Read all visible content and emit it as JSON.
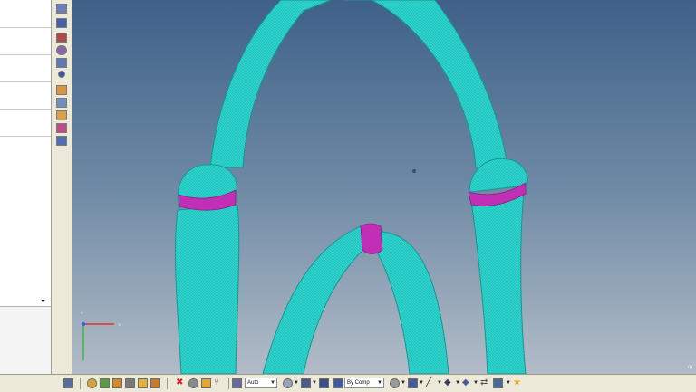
{
  "toolbar": {
    "display_mode": "Auto",
    "color_mode": "By Comp"
  },
  "viewport": {
    "scale_label": "m",
    "model_color": "#28cfc9",
    "highlight_color": "#c02fb5"
  }
}
